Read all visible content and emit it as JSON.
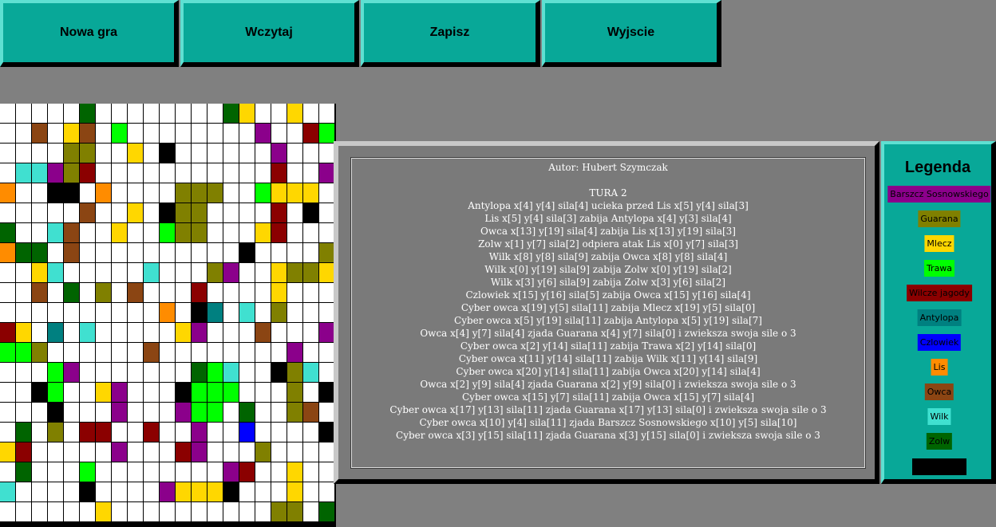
{
  "menu": {
    "new_game": "Nowa gra",
    "load": "Wczytaj",
    "save": "Zapisz",
    "exit": "Wyjscie"
  },
  "log": {
    "lines": [
      "Autor: Hubert Szymczak",
      "",
      "TURA 2",
      "Antylopa x[4] y[4] sila[4] ucieka przed Lis x[5] y[4] sila[3]",
      "Lis x[5] y[4] sila[3] zabija Antylopa x[4] y[3] sila[4]",
      "Owca x[13] y[19] sila[4] zabija Lis x[13] y[19] sila[3]",
      "Zolw x[1] y[7] sila[2] odpiera atak Lis x[0] y[7] sila[3]",
      "Wilk x[8] y[8] sila[9] zabija Owca x[8] y[8] sila[4]",
      "Wilk x[0] y[19] sila[9] zabija Zolw x[0] y[19] sila[2]",
      "Wilk x[3] y[6] sila[9] zabija Zolw x[3] y[6] sila[2]",
      "Czlowiek x[15] y[16] sila[5] zabija Owca x[15] y[16] sila[4]",
      "Cyber owca x[19] y[5] sila[11] zabija Mlecz x[19] y[5] sila[0]",
      "Cyber owca x[5] y[19] sila[11] zabija Antylopa x[5] y[19] sila[7]",
      "Owca x[4] y[7] sila[4] zjada Guarana x[4] y[7] sila[0] i zwieksza swoja sile o 3",
      "Cyber owca x[2] y[14] sila[11] zabija Trawa x[2] y[14] sila[0]",
      "Cyber owca x[11] y[14] sila[11] zabija Wilk x[11] y[14] sila[9]",
      "Cyber owca x[20] y[14] sila[11] zabija Owca x[20] y[14] sila[4]",
      "Owca x[2] y[9] sila[4] zjada Guarana x[2] y[9] sila[0] i zwieksza swoja sile o 3",
      "Cyber owca x[15] y[7] sila[11] zabija Owca x[15] y[7] sila[4]",
      "Cyber owca x[17] y[13] sila[11] zjada Guarana x[17] y[13] sila[0] i zwieksza swoja sile o 3",
      "Cyber owca x[10] y[4] sila[11] zjada Barszcz Sosnowskiego x[10] y[5] sila[10]",
      "Cyber owca x[3] y[15] sila[11] zjada Guarana x[3] y[15] sila[0] i zwieksza swoja sile o 3"
    ]
  },
  "legend": {
    "title": "Legenda",
    "items": [
      {
        "label": "Barszcz Sosnowskiego",
        "color": "#8b008b",
        "text_color": "#000000"
      },
      {
        "label": "Guarana",
        "color": "#808000",
        "text_color": "#000000"
      },
      {
        "label": "Mlecz",
        "color": "#ffd700",
        "text_color": "#000000"
      },
      {
        "label": "Trawa",
        "color": "#00ff00",
        "text_color": "#000000"
      },
      {
        "label": "Wilcze jagody",
        "color": "#8b0000",
        "text_color": "#000000"
      },
      {
        "label": "Antylopa",
        "color": "#008080",
        "text_color": "#000000"
      },
      {
        "label": "Czlowiek",
        "color": "#0000ff",
        "text_color": "#000000"
      },
      {
        "label": "Lis",
        "color": "#ff8c00",
        "text_color": "#000000"
      },
      {
        "label": "Owca",
        "color": "#8b4513",
        "text_color": "#000000"
      },
      {
        "label": "Wilk",
        "color": "#40e0d0",
        "text_color": "#000000"
      },
      {
        "label": "Zolw",
        "color": "#006400",
        "text_color": "#000000"
      },
      {
        "label": "",
        "color": "#000000",
        "text_color": "#ffffff"
      }
    ]
  },
  "board": {
    "colors": {
      "W": "#ffffff",
      "D": "#006400",
      "Y": "#ffd700",
      "P": "#8b008b",
      "R": "#8b0000",
      "G": "#00ff00",
      "B": "#8b4513",
      "O": "#808000",
      "K": "#000000",
      "C": "#40e0d0",
      "T": "#008080",
      "N": "#ff8c00",
      "U": "#0000ff"
    },
    "rows": [
      "WWWWWDWWWWWWWWDYWWYWW",
      "WWBWYBWGWWWWWWWWPWWRG",
      "WWWWOOWWYWKWWWWWWPWWW",
      "WCCPORWWWWWWWWWWWRWWP",
      "NWWKKWNWWWWOOOWWGYYYW",
      "WWWWWBWWYWKOOWWWWRWKW",
      "DWWCBWWYWWGOOWWWYRWWW",
      "NDDWBWWWWWWWWWWKWWWWO",
      "WWYCWWWWWCWWWOPWWYOOY",
      "WWBWDWOWBWWWRWWWWYWWW",
      "WWWWWWWWWWNWKTWCWOWWW",
      "RYWTWCWWWWWYPWWWBWWWP",
      "GGOWWWWWWBWWWWWWWWPWW",
      "WWWGPWWWWWWWDGCWWKOCW",
      "WWKGWWYPWWWKGGGWWWOWK",
      "WWWKWWWPWWWPGGWDWWOBW",
      "WDWOWRRWWRWWPWWUWWWWK",
      "YRWWWWWPWWWRPWWWOWWWW",
      "WDWWWGWWWWWWWWPRWWYWW",
      "CWWWWKWWWWPYYYKWWWYWW",
      "WWWWWWYWWWWWWWWWWOOWD"
    ]
  }
}
